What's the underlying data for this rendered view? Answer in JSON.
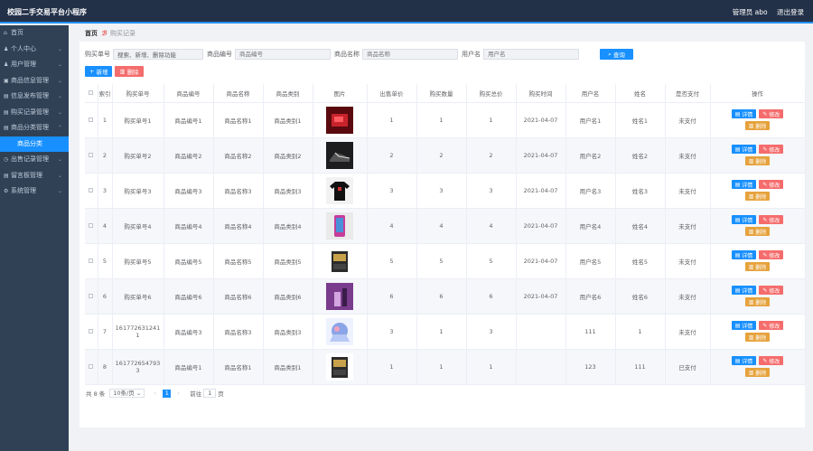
{
  "app": {
    "title": "校园二手交易平台小程序",
    "user": "管理员 abo",
    "logout": "退出登录"
  },
  "sidebar": {
    "items": [
      {
        "label": "首页",
        "icon": "⌂",
        "chev": ""
      },
      {
        "label": "个人中心",
        "icon": "♟",
        "chev": "⌄"
      },
      {
        "label": "用户管理",
        "icon": "♟",
        "chev": "⌄"
      },
      {
        "label": "商品信息管理",
        "icon": "▣",
        "chev": "⌄"
      },
      {
        "label": "信息发布管理",
        "icon": "▤",
        "chev": "⌄"
      },
      {
        "label": "购买记录管理",
        "icon": "▤",
        "chev": "⌄"
      },
      {
        "label": "商品分类管理",
        "icon": "▤",
        "chev": "⌃"
      },
      {
        "label": "商品分类",
        "icon": "",
        "chev": ""
      },
      {
        "label": "出售记录管理",
        "icon": "◷",
        "chev": "⌄"
      },
      {
        "label": "留言板管理",
        "icon": "▤",
        "chev": "⌄"
      },
      {
        "label": "系统管理",
        "icon": "⚙",
        "chev": "⌄"
      }
    ]
  },
  "breadcrumb": {
    "home": "首页",
    "sep": "ℬ",
    "current": "购买记录"
  },
  "search": {
    "f1_label": "购买单号",
    "f1_value": "搜索、新增、删除功能",
    "f2_label": "商品编号",
    "f2_placeholder": "商品编号",
    "f3_label": "商品名称",
    "f3_placeholder": "商品名称",
    "f4_label": "用户名",
    "f4_placeholder": "用户名",
    "button": "查询"
  },
  "actions": {
    "add": "新增",
    "delete": "删除"
  },
  "table": {
    "headers": [
      "",
      "索引",
      "购买单号",
      "商品编号",
      "商品名称",
      "商品类别",
      "图片",
      "出售单价",
      "购买数量",
      "购买总价",
      "购买时间",
      "用户名",
      "姓名",
      "是否支付",
      "操作"
    ],
    "op_detail": "详情",
    "op_edit": "修改",
    "op_delete": "删除",
    "rows": [
      {
        "index": "1",
        "order": "购买单号1",
        "code": "商品编号1",
        "name": "商品名称1",
        "cat": "商品类别1",
        "img": "red",
        "price": "1",
        "qty": "1",
        "total": "1",
        "time": "2021-04-07",
        "user": "用户名1",
        "real": "姓名1",
        "paid": "未支付"
      },
      {
        "index": "2",
        "order": "购买单号2",
        "code": "商品编号2",
        "name": "商品名称2",
        "cat": "商品类别2",
        "img": "shoe",
        "price": "2",
        "qty": "2",
        "total": "2",
        "time": "2021-04-07",
        "user": "用户名2",
        "real": "姓名2",
        "paid": "未支付"
      },
      {
        "index": "3",
        "order": "购买单号3",
        "code": "商品编号3",
        "name": "商品名称3",
        "cat": "商品类别3",
        "img": "shirt",
        "price": "3",
        "qty": "3",
        "total": "3",
        "time": "2021-04-07",
        "user": "用户名3",
        "real": "姓名3",
        "paid": "未支付"
      },
      {
        "index": "4",
        "order": "购买单号4",
        "code": "商品编号4",
        "name": "商品名称4",
        "cat": "商品类别4",
        "img": "phone",
        "price": "4",
        "qty": "4",
        "total": "4",
        "time": "2021-04-07",
        "user": "用户名4",
        "real": "姓名4",
        "paid": "未支付"
      },
      {
        "index": "5",
        "order": "购买单号5",
        "code": "商品编号5",
        "name": "商品名称5",
        "cat": "商品类别5",
        "img": "box",
        "price": "5",
        "qty": "5",
        "total": "5",
        "time": "2021-04-07",
        "user": "用户名5",
        "real": "姓名5",
        "paid": "未支付"
      },
      {
        "index": "6",
        "order": "购买单号6",
        "code": "商品编号6",
        "name": "商品名称6",
        "cat": "商品类别6",
        "img": "purple",
        "price": "6",
        "qty": "6",
        "total": "6",
        "time": "2021-04-07",
        "user": "用户名6",
        "real": "姓名6",
        "paid": "未支付"
      },
      {
        "index": "7",
        "order": "1617726312411",
        "code": "商品编号3",
        "name": "商品名称3",
        "cat": "商品类别3",
        "img": "anime",
        "price": "3",
        "qty": "1",
        "total": "3",
        "time": "",
        "user": "111",
        "real": "1",
        "paid": "未支付"
      },
      {
        "index": "8",
        "order": "1617726547933",
        "code": "商品编号1",
        "name": "商品名称1",
        "cat": "商品类别1",
        "img": "box",
        "price": "1",
        "qty": "1",
        "total": "1",
        "time": "",
        "user": "123",
        "real": "111",
        "paid": "已支付"
      }
    ]
  },
  "pager": {
    "total": "共 8 条",
    "size": "10条/页",
    "prev": "‹",
    "page": "1",
    "next": "›",
    "goto_label": "前往",
    "goto_value": "1",
    "goto_unit": "页"
  },
  "colors": {
    "primary": "#1890ff",
    "danger": "#f56c6c",
    "warning": "#e6a23c",
    "sidebar": "#304156",
    "topbar": "#233148"
  }
}
